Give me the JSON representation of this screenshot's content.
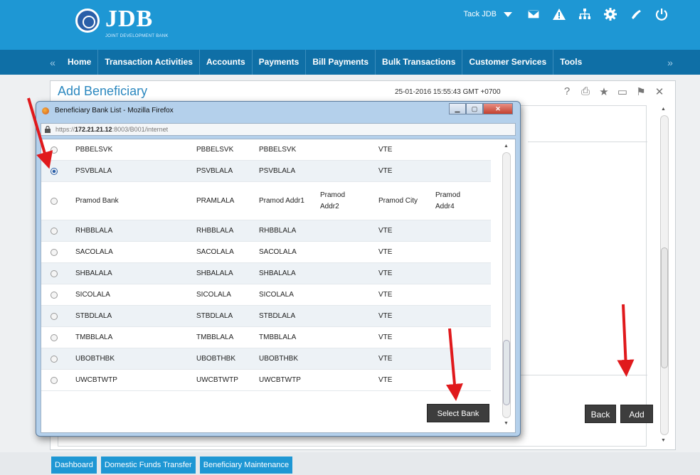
{
  "header": {
    "logo_name": "JDB",
    "logo_subtitle": "JOINT DEVELOPMENT BANK",
    "user_name": "Tack JDB",
    "icons": [
      "chevron-down-icon",
      "mail-icon",
      "alert-icon",
      "org-chart-icon",
      "gear-icon",
      "phone-icon",
      "power-icon"
    ]
  },
  "nav": {
    "left_arrow": "«",
    "right_arrow": "»",
    "items": [
      "Home",
      "Transaction Activities",
      "Accounts",
      "Payments",
      "Bill Payments",
      "Bulk Transactions",
      "Customer Services",
      "Tools"
    ]
  },
  "panel": {
    "title": "Add Beneficiary",
    "datetime": "25-01-2016 15:55:43 GMT +0700",
    "tool_icons": [
      "help-icon",
      "print-icon",
      "star-icon",
      "minimize-icon",
      "flag-icon",
      "close-icon"
    ],
    "back_label": "Back",
    "add_label": "Add"
  },
  "popup": {
    "title": "Beneficiary Bank List - Mozilla Firefox",
    "url_prefix": "https://",
    "url_host": "172.21.21.12",
    "url_rest": ":8003/B001/internet",
    "select_label": "Select Bank",
    "rows": [
      {
        "name": "PBBELSVK",
        "code": "PBBELSVK",
        "addr1": "PBBELSVK",
        "addr2": "",
        "city": "VTE",
        "addr4": "",
        "selected": false
      },
      {
        "name": "PSVBLALA",
        "code": "PSVBLALA",
        "addr1": "PSVBLALA",
        "addr2": "",
        "city": "VTE",
        "addr4": "",
        "selected": true
      },
      {
        "name": "Pramod Bank",
        "code": "PRAMLALA",
        "addr1": "Pramod Addr1",
        "addr2": "Pramod Addr2",
        "city": "Pramod City",
        "addr4": "Pramod Addr4",
        "selected": false
      },
      {
        "name": "RHBBLALA",
        "code": "RHBBLALA",
        "addr1": "RHBBLALA",
        "addr2": "",
        "city": "VTE",
        "addr4": "",
        "selected": false
      },
      {
        "name": "SACOLALA",
        "code": "SACOLALA",
        "addr1": "SACOLALA",
        "addr2": "",
        "city": "VTE",
        "addr4": "",
        "selected": false
      },
      {
        "name": "SHBALALA",
        "code": "SHBALALA",
        "addr1": "SHBALALA",
        "addr2": "",
        "city": "VTE",
        "addr4": "",
        "selected": false
      },
      {
        "name": "SICOLALA",
        "code": "SICOLALA",
        "addr1": "SICOLALA",
        "addr2": "",
        "city": "VTE",
        "addr4": "",
        "selected": false
      },
      {
        "name": "STBDLALA",
        "code": "STBDLALA",
        "addr1": "STBDLALA",
        "addr2": "",
        "city": "VTE",
        "addr4": "",
        "selected": false
      },
      {
        "name": "TMBBLALA",
        "code": "TMBBLALA",
        "addr1": "TMBBLALA",
        "addr2": "",
        "city": "VTE",
        "addr4": "",
        "selected": false
      },
      {
        "name": "UBOBTHBK",
        "code": "UBOBTHBK",
        "addr1": "UBOBTHBK",
        "addr2": "",
        "city": "VTE",
        "addr4": "",
        "selected": false
      },
      {
        "name": "UWCBTWTP",
        "code": "UWCBTWTP",
        "addr1": "UWCBTWTP",
        "addr2": "",
        "city": "VTE",
        "addr4": "",
        "selected": false
      }
    ]
  },
  "bottom_tabs": [
    "Dashboard",
    "Domestic Funds Transfer",
    "Beneficiary Maintenance"
  ],
  "colors": {
    "header_blue": "#1e97d4",
    "nav_blue": "#0f6fa6",
    "title_blue": "#2c88bf",
    "annotation_red": "#e0191c"
  }
}
